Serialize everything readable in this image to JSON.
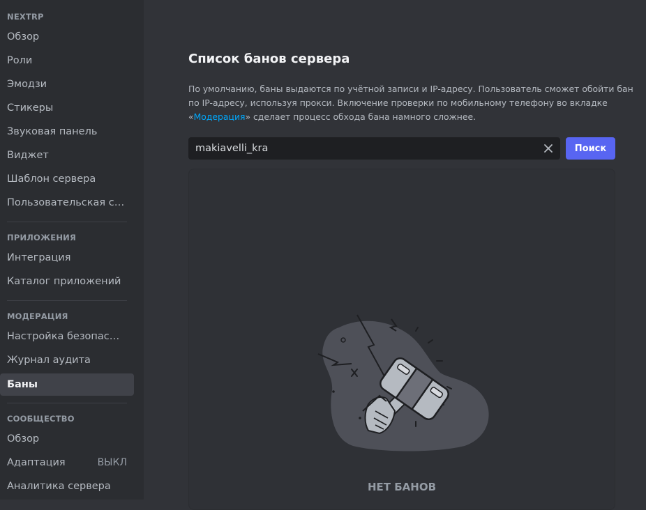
{
  "sidebar": {
    "sections": [
      {
        "header": "NEXTRP",
        "items": [
          {
            "label": "Обзор"
          },
          {
            "label": "Роли"
          },
          {
            "label": "Эмодзи"
          },
          {
            "label": "Стикеры"
          },
          {
            "label": "Звуковая панель"
          },
          {
            "label": "Виджет"
          },
          {
            "label": "Шаблон сервера"
          },
          {
            "label": "Пользовательская сс..."
          }
        ]
      },
      {
        "header": "ПРИЛОЖЕНИЯ",
        "items": [
          {
            "label": "Интеграция"
          },
          {
            "label": "Каталог приложений"
          }
        ]
      },
      {
        "header": "МОДЕРАЦИЯ",
        "items": [
          {
            "label": "Настройка безопасно..."
          },
          {
            "label": "Журнал аудита"
          },
          {
            "label": "Баны",
            "active": true
          }
        ]
      },
      {
        "header": "СООБЩЕСТВО",
        "items": [
          {
            "label": "Обзор"
          },
          {
            "label": "Адаптация",
            "status": "ВЫКЛ"
          },
          {
            "label": "Аналитика сервера"
          }
        ]
      }
    ]
  },
  "main": {
    "title": "Список банов сервера",
    "description": {
      "line1": "По умолчанию, баны выдаются по учётной записи и IP-адресу. Пользователь сможет обойти бан",
      "line2": "по IP-адресу, используя прокси. Включение проверки по мобильному телефону во вкладке",
      "line3_prefix": "«",
      "line3_link": "Модерация",
      "line3_suffix": "» сделает процесс обхода бана намного сложнее."
    },
    "search": {
      "value": "makiavelli_kra",
      "button_label": "Поиск"
    },
    "empty_state": {
      "label": "НЕТ БАНОВ",
      "icon": "ban-hammer-icon"
    }
  },
  "colors": {
    "accent": "#5865f2",
    "link": "#00a8fc",
    "background": "#313338",
    "sidebar": "#2b2d31"
  }
}
